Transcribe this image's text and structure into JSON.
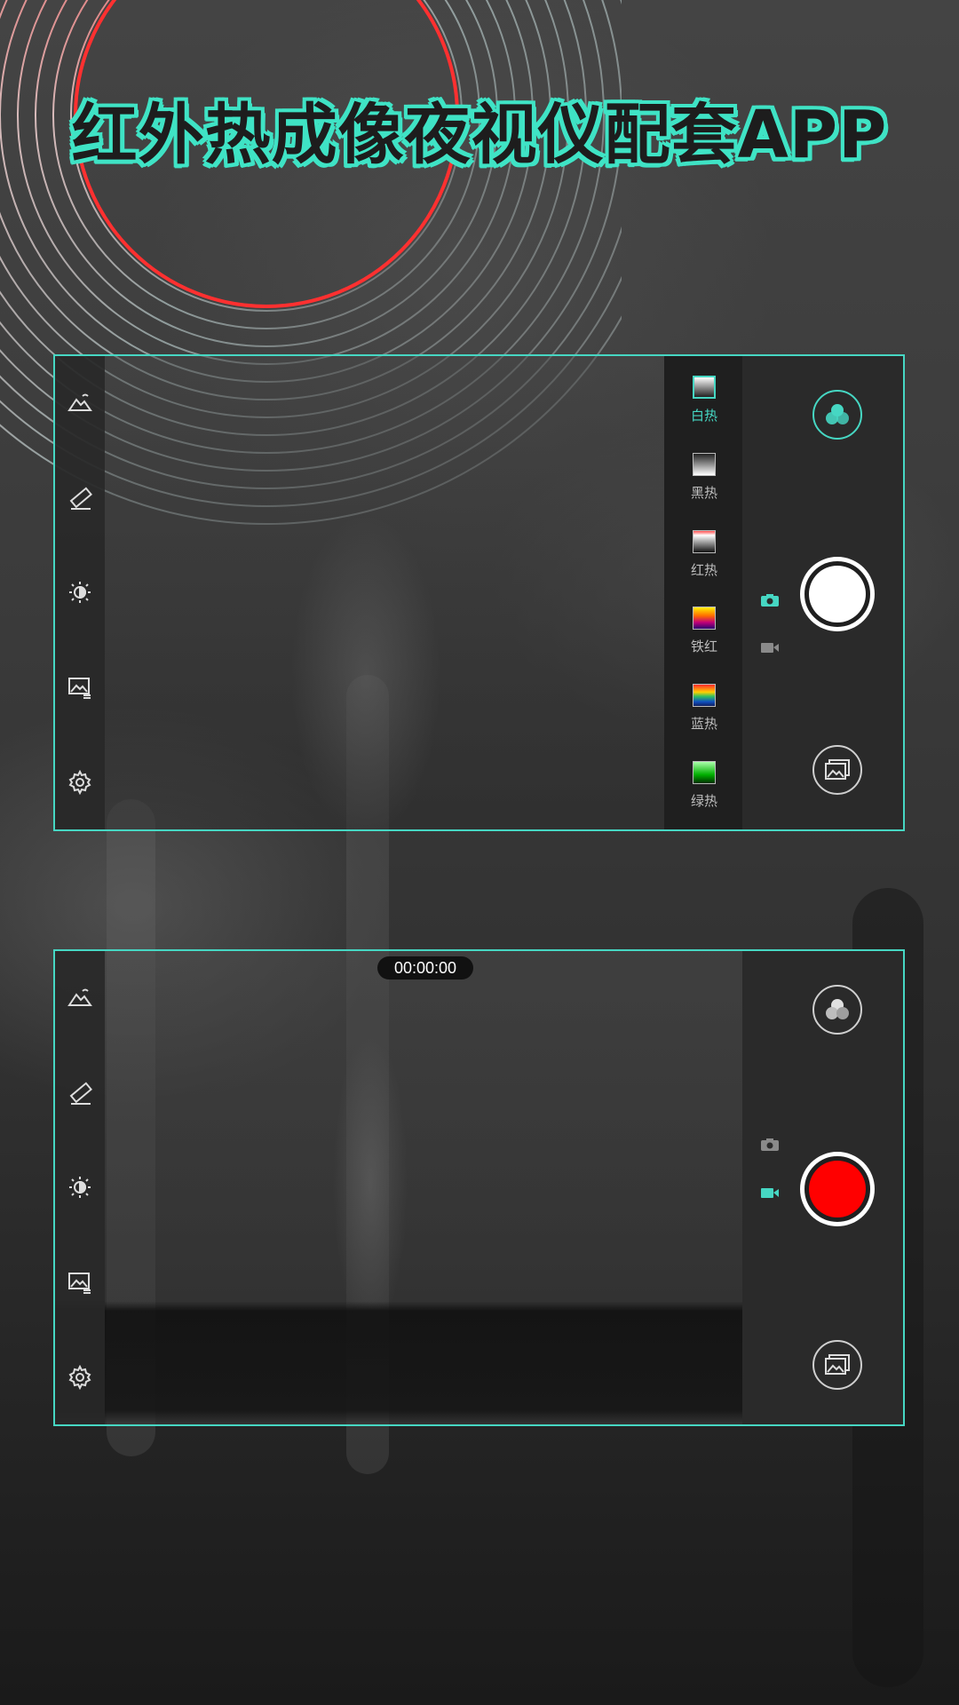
{
  "title": "红外热成像夜视仪配套APP",
  "colors": {
    "accent": "#46d7c3",
    "record": "#ff0000",
    "shutter": "#ffffff"
  },
  "left_toolbar": [
    {
      "name": "scene",
      "icon": "landscape-icon"
    },
    {
      "name": "measure",
      "icon": "ruler-icon"
    },
    {
      "name": "brightness",
      "icon": "brightness-icon"
    },
    {
      "name": "image-adjust",
      "icon": "image-adjust-icon"
    },
    {
      "name": "settings",
      "icon": "gear-icon"
    }
  ],
  "palettes": [
    {
      "label": "白热",
      "active": true
    },
    {
      "label": "黑热",
      "active": false
    },
    {
      "label": "红热",
      "active": false
    },
    {
      "label": "铁红",
      "active": false
    },
    {
      "label": "蓝热",
      "active": false
    },
    {
      "label": "绿热",
      "active": false
    }
  ],
  "photo_panel": {
    "mode": "photo",
    "shutter_icon": "capture-button"
  },
  "video_panel": {
    "mode": "video",
    "timer": "00:00:00",
    "shutter_icon": "record-button"
  }
}
